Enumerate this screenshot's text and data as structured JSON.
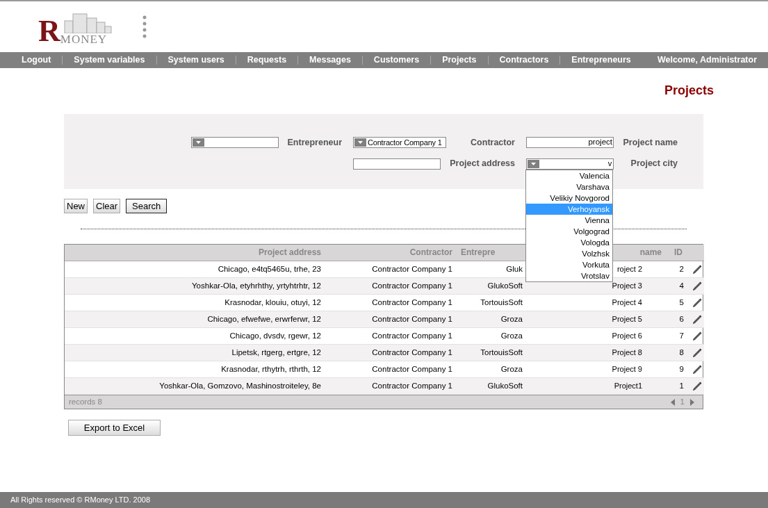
{
  "logo": {
    "initial": "R",
    "word": "MONEY"
  },
  "nav": {
    "items": [
      "Logout",
      "System variables",
      "System users",
      "Requests",
      "Messages",
      "Customers",
      "Projects",
      "Contractors",
      "Entrepreneurs"
    ],
    "welcome": "Welcome, Administrator"
  },
  "page_title": "Projects",
  "filters": [
    [
      {
        "kind": "select"
      },
      {
        "kind": "label",
        "text": "Entrepreneur"
      },
      {
        "kind": "select",
        "value": "Contractor Company 1"
      },
      {
        "kind": "label",
        "text": "Contractor"
      },
      {
        "kind": "text",
        "value": "project"
      },
      {
        "kind": "label",
        "text": "Project name"
      }
    ],
    [
      {
        "kind": "text"
      },
      {
        "kind": "label",
        "text": "Project address"
      },
      {
        "kind": "select",
        "value": "v",
        "options": [
          {
            "label": "Valencia",
            "selected": false
          },
          {
            "label": "Varshava",
            "selected": false
          },
          {
            "label": "Velikiy Novgorod",
            "selected": false
          },
          {
            "label": "Verhoyansk",
            "selected": true
          },
          {
            "label": "Vienna",
            "selected": false
          },
          {
            "label": "Volgograd",
            "selected": false
          },
          {
            "label": "Vologda",
            "selected": false
          },
          {
            "label": "Volzhsk",
            "selected": false
          },
          {
            "label": "Vorkuta",
            "selected": false
          },
          {
            "label": "Vrotslav",
            "selected": false
          }
        ]
      },
      {
        "kind": "label",
        "text": "Project city"
      }
    ]
  ],
  "buttons": [
    {
      "label": "New",
      "focused": false
    },
    {
      "label": "Clear",
      "focused": false
    },
    {
      "label": "Search",
      "focused": true
    }
  ],
  "table": {
    "columns": [
      "Project address",
      "Contractor",
      "Entrepre",
      "name",
      "ID"
    ],
    "rows": [
      [
        "Chicago, e4tq5465u, trhe, 23",
        "Contractor Company 1",
        "Gluk",
        "roject 2",
        "2"
      ],
      [
        "Yoshkar-Ola, etyhrhthy, yrtyhtrhtr, 12",
        "Contractor Company 1",
        "GlukoSoft",
        "Project 3",
        "4"
      ],
      [
        "Krasnodar, klouiu, otuyi, 12",
        "Contractor Company 1",
        "TortouisSoft",
        "Project 4",
        "5"
      ],
      [
        "Chicago, efwefwe, erwrferwr, 12",
        "Contractor Company 1",
        "Groza",
        "Project 5",
        "6"
      ],
      [
        "Chicago, dvsdv, rgewr, 12",
        "Contractor Company 1",
        "Groza",
        "Project 6",
        "7"
      ],
      [
        "Lipetsk, rtgerg, ertgre, 12",
        "Contractor Company 1",
        "TortouisSoft",
        "Project 8",
        "8"
      ],
      [
        "Krasnodar, rthytrh, rthrth, 12",
        "Contractor Company 1",
        "Groza",
        "Project 9",
        "9"
      ],
      [
        "Yoshkar-Ola, Gomzovo, Mashinostroiteley, 8e",
        "Contractor Company 1",
        "GlukoSoft",
        "Project1",
        "1"
      ]
    ],
    "records": "records 8",
    "page": "1"
  },
  "export_button": "Export to Excel",
  "footer": "All Rights reserved © RMoney LTD. 2008"
}
